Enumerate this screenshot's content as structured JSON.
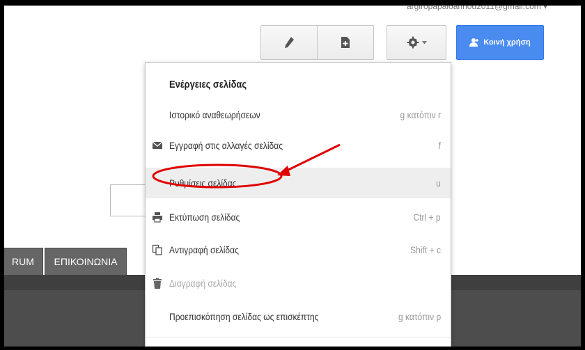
{
  "header": {
    "account_email": "argiropapaioannou2011@gmail.com ▾"
  },
  "toolbar": {
    "edit_icon": "pencil-icon",
    "new_page_icon": "new-page-icon",
    "settings_icon": "gear-icon",
    "share_label": "Κοινή χρήση",
    "share_color": "#4a8bf0"
  },
  "nav": {
    "tabs": [
      {
        "label": "RUM"
      },
      {
        "label": "ΕΠΙΚΟΙΝΩΝΙΑ"
      }
    ]
  },
  "menu": {
    "heading": "Ενέργειες σελίδας",
    "items": [
      {
        "label": "Ιστορικό αναθεωρήσεων",
        "shortcut": "g κατόπιν r",
        "icon": ""
      },
      {
        "label": "Εγγραφή στις αλλαγές σελίδας",
        "shortcut": "f",
        "icon": "mail-icon"
      },
      {
        "label": "Ρυθμίσεις σελίδας",
        "shortcut": "u",
        "icon": "",
        "highlighted": true
      },
      {
        "label": "Εκτύπωση σελίδας",
        "shortcut": "Ctrl + p",
        "icon": "printer-icon"
      },
      {
        "label": "Αντιγραφή σελίδας",
        "shortcut": "Shift + c",
        "icon": "copy-icon"
      },
      {
        "label": "Διαγραφή σελίδας",
        "shortcut": "",
        "icon": "trash-icon",
        "disabled": true
      },
      {
        "label": "Προεπισκόπηση σελίδας ως επισκέπτης",
        "shortcut": "g κατόπιν p",
        "icon": ""
      }
    ]
  },
  "annotation": {
    "color": "#e00000"
  }
}
